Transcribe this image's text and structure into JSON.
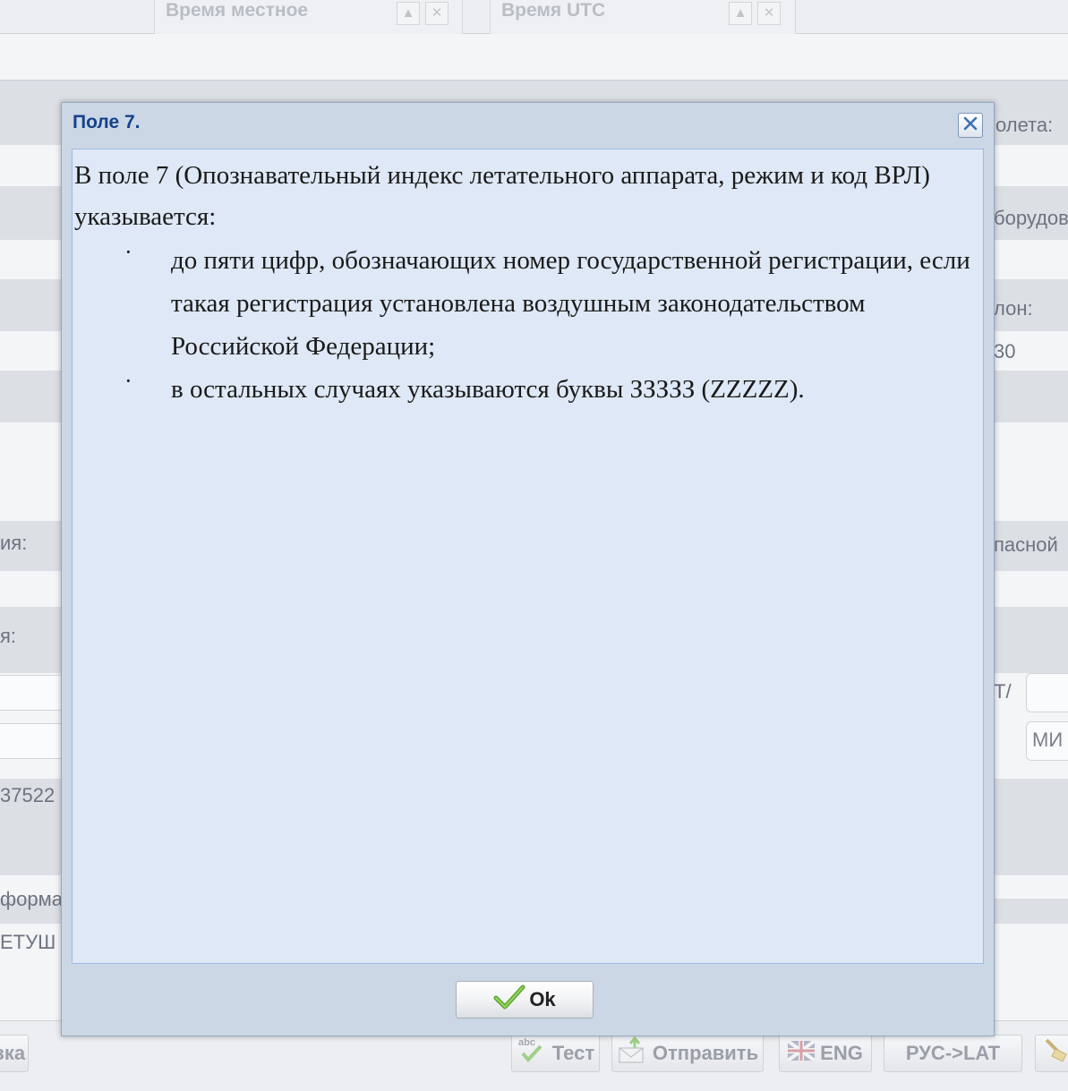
{
  "background": {
    "headers": [
      {
        "label": "Время местное"
      },
      {
        "label": "Время UTC"
      }
    ],
    "right_fragments": {
      "flight_label": "олета:",
      "equipment_label": "борудов",
      "phone_label": "лон:",
      "phone_value": "30",
      "alternate_label": "пасной",
      "slash_label": "Т/",
      "min_field": "МИ"
    },
    "left_fragments": {
      "name_label_1": "ия:",
      "name_label_2": "я:",
      "number_value": "37522",
      "info_label": "форма",
      "pilot_value": "ЕТУШ",
      "bottom_label": "зка"
    },
    "toolbar": {
      "test_label": "Тест",
      "send_label": "Отправить",
      "eng_label": "ENG",
      "translit_label": "РУС->LAT"
    }
  },
  "dialog": {
    "title": "Поле 7.",
    "intro": "В поле 7 (Опознавательный индекс летательного аппарата, режим и код ВРЛ) указывается:",
    "bullets": [
      {
        "mark": "·",
        "text": "до пяти цифр, обозначающих номер государственной регистрации, если такая регистрация установлена воздушным законодательством Российской Федерации;"
      },
      {
        "mark": "·",
        "text": "в остальных случаях указываются буквы ЗЗЗЗЗ (ZZZZZ)."
      }
    ],
    "ok_label": "Ok"
  }
}
